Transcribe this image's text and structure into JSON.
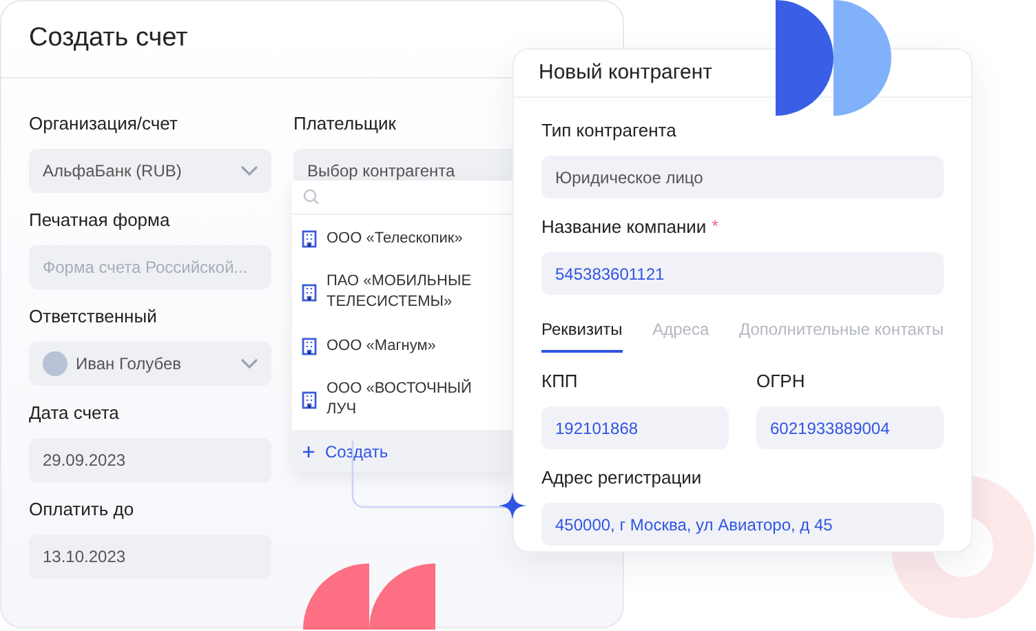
{
  "invoice_card": {
    "title": "Создать счет",
    "fields": [
      {
        "kind": "select",
        "label": "Организация/счет",
        "value": "АльфаБанк (RUB)"
      },
      {
        "kind": "input",
        "label": "Печатная форма",
        "placeholder": "Форма счета Российской..."
      },
      {
        "kind": "person",
        "label": "Ответственный",
        "value": "Иван Голубев"
      },
      {
        "kind": "input",
        "label": "Дата счета",
        "value": "29.09.2023"
      },
      {
        "kind": "input",
        "label": "Оплатить до",
        "value": "13.10.2023"
      }
    ],
    "payer": {
      "label": "Плательщик",
      "placeholder": "Выбор контрагента",
      "dropdown": [
        {
          "kind": "company",
          "text": "ООО «Телескопик»"
        },
        {
          "kind": "company",
          "text": "ПАО «МОБИЛЬНЫЕ ТЕЛЕСИСТЕМЫ»"
        },
        {
          "kind": "company",
          "text": "ООО «Магнум»"
        },
        {
          "kind": "company",
          "text": "ООО «ВОСТОЧНЫЙ ЛУЧ"
        },
        {
          "kind": "create",
          "text": "Создать"
        }
      ]
    }
  },
  "counterparty_card": {
    "title": "Новый контрагент",
    "type_field": {
      "label": "Тип контрагента",
      "value": "Юридическое лицо"
    },
    "name_field": {
      "label": "Название компании",
      "required_mark": "*",
      "value": "545383601121"
    },
    "tabs": [
      {
        "label": "Реквизиты",
        "selected": true
      },
      {
        "label": "Адреса",
        "selected": false
      },
      {
        "label": "Дополнительные контакты",
        "selected": false
      }
    ],
    "kpp": {
      "label": "КПП",
      "value": "192101868"
    },
    "ogrn": {
      "label": "ОГРН",
      "value": "6021933889004"
    },
    "address": {
      "label": "Адрес регистрации",
      "value": "450000, г Москва, ул Авиаторо, д 45"
    }
  }
}
